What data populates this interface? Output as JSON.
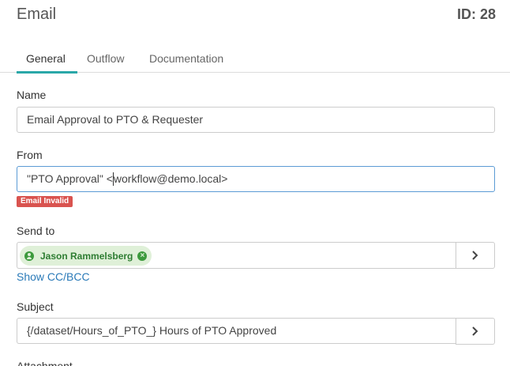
{
  "header": {
    "title": "Email",
    "id_label": "ID: 28"
  },
  "tabs": [
    {
      "label": "General",
      "active": true
    },
    {
      "label": "Outflow",
      "active": false
    },
    {
      "label": "Documentation",
      "active": false
    }
  ],
  "form": {
    "name": {
      "label": "Name",
      "value": "Email Approval to PTO & Requester"
    },
    "from": {
      "label": "From",
      "value_before_caret": "\"PTO Approval\" <",
      "value_after_caret": "workflow@demo.local>",
      "error": "Email Invalid"
    },
    "send_to": {
      "label": "Send to",
      "recipients": [
        {
          "name": "Jason Rammelsberg"
        }
      ],
      "cc_link": "Show CC/BCC"
    },
    "subject": {
      "label": "Subject",
      "value": "{/dataset/Hours_of_PTO_} Hours of PTO Approved"
    },
    "attachment": {
      "label": "Attachment"
    }
  },
  "colors": {
    "accent": "#2aa7a8",
    "error": "#d9534f",
    "chip_bg": "#dff0d8",
    "chip_fg": "#2e7d32",
    "link": "#2a7ab8"
  },
  "icons": {
    "arrow": "chevron-right-icon",
    "remove": "close-circle-icon",
    "avatar": "user-circle-icon"
  }
}
